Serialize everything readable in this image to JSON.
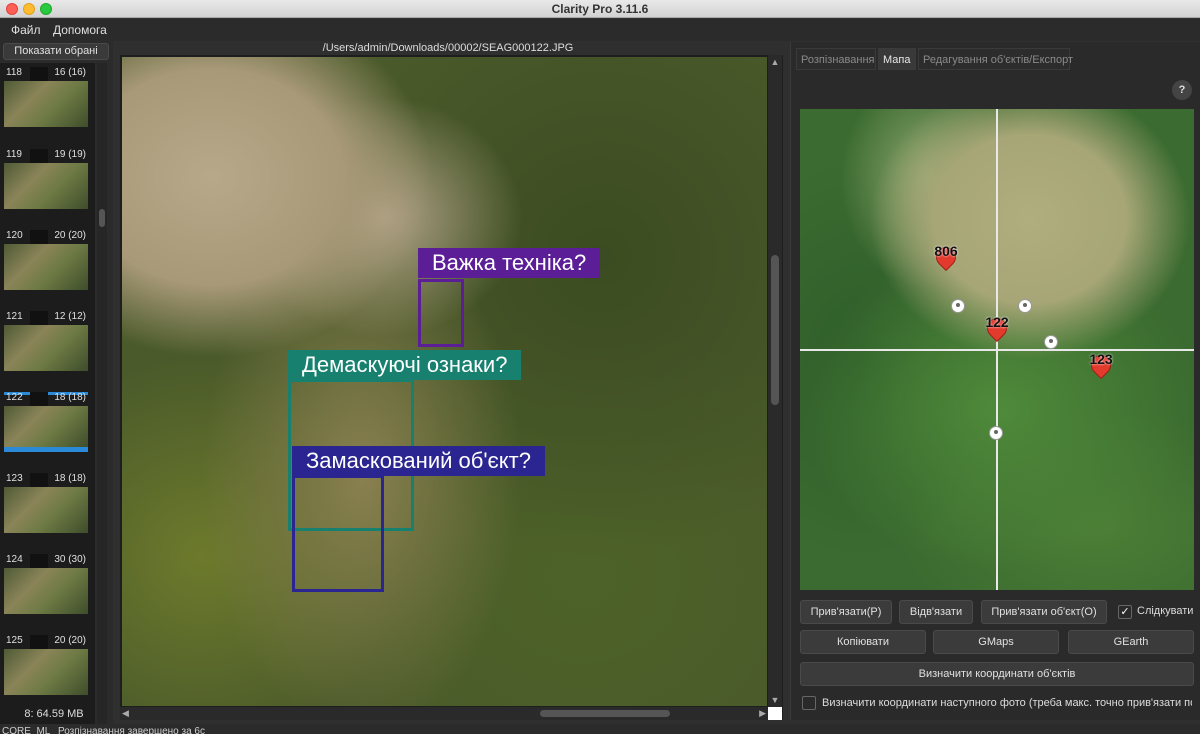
{
  "window": {
    "title": "Clarity Pro 3.11.6"
  },
  "menu": {
    "file": "Файл",
    "help": "Допомога"
  },
  "left_panel": {
    "show_selected": "Показати обрані",
    "thumbnails": [
      {
        "index": "118",
        "count": "16 (16)",
        "selected": false
      },
      {
        "index": "119",
        "count": "19 (19)",
        "selected": false
      },
      {
        "index": "120",
        "count": "20 (20)",
        "selected": false
      },
      {
        "index": "121",
        "count": "12 (12)",
        "selected": false
      },
      {
        "index": "122",
        "count": "18 (18)",
        "selected": true
      },
      {
        "index": "123",
        "count": "18 (18)",
        "selected": false
      },
      {
        "index": "124",
        "count": "30 (30)",
        "selected": false
      },
      {
        "index": "125",
        "count": "20 (20)",
        "selected": false
      }
    ],
    "memory": "8: 64.59 MB"
  },
  "viewer": {
    "path": "/Users/admin/Downloads/00002/SEAG000122.JPG",
    "detections": [
      {
        "label": "Важка техніка?",
        "color": "#5b1e96"
      },
      {
        "label": "Демаскуючі ознаки?",
        "color": "#17806f"
      },
      {
        "label": "Замаскований об'єкт?",
        "color": "#2a2590"
      }
    ]
  },
  "right_panel": {
    "tabs": [
      "Розпізнавання",
      "Мапа",
      "Редагування об'єктів/Експорт"
    ],
    "active_tab": "Мапа",
    "help": "?",
    "map_markers": [
      "806",
      "122",
      "123"
    ],
    "buttons": {
      "bind": "Прив'язати(Р)",
      "unbind": "Відв'язати",
      "bind_object": "Прив'язати об'єкт(О)",
      "follow": "Слідкувати",
      "copy": "Копіювати",
      "gmaps": "GMaps",
      "gearth": "GEarth",
      "determine_coords": "Визначити координати об'єктів",
      "next_photo": "Визначити координати наступного фото (треба макс. точно прив'язати поп..."
    },
    "follow_checked": true,
    "next_photo_checked": false
  },
  "status": {
    "core": "CORE_ML",
    "message": "Розпізнавання завершено за 6с"
  }
}
